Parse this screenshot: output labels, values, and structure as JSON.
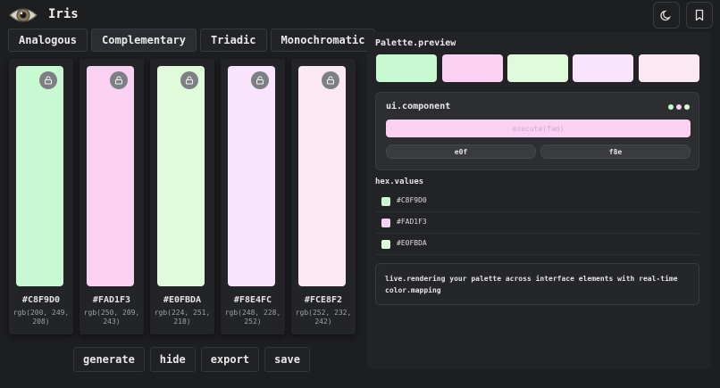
{
  "app": {
    "title": "Iris"
  },
  "tabs": [
    {
      "label": "Analogous"
    },
    {
      "label": "Complementary"
    },
    {
      "label": "Triadic"
    },
    {
      "label": "Monochromatic"
    }
  ],
  "swatches": [
    {
      "hex": "#C8F9D0",
      "rgb": "rgb(200, 249, 208)",
      "color": "#C8F9D0"
    },
    {
      "hex": "#FAD1F3",
      "rgb": "rgb(250, 209, 243)",
      "color": "#FAD1F3"
    },
    {
      "hex": "#E0FBDA",
      "rgb": "rgb(224, 251, 218)",
      "color": "#E0FBDA"
    },
    {
      "hex": "#F8E4FC",
      "rgb": "rgb(248, 228, 252)",
      "color": "#F8E4FC"
    },
    {
      "hex": "#FCE8F2",
      "rgb": "rgb(252, 232, 242)",
      "color": "#FCE8F2"
    }
  ],
  "actions": {
    "generate": "generate",
    "hide": "hide",
    "export": "export",
    "save": "save"
  },
  "preview": {
    "title": "Palette.preview",
    "component_title": "ui.component",
    "execute_label": "execute(fad)",
    "chip_left": "e0f",
    "chip_right": "f8e",
    "hex_title": "hex.values",
    "hex_values": [
      "#C8F9D0",
      "#FAD1F3",
      "#E0FBDA"
    ],
    "note": "live.rendering your palette across interface elements with real-time color.mapping"
  },
  "icons": {
    "logo": "eye-icon",
    "theme": "moon-icon",
    "bookmark": "bookmark-icon",
    "lock": "lock-icon"
  }
}
